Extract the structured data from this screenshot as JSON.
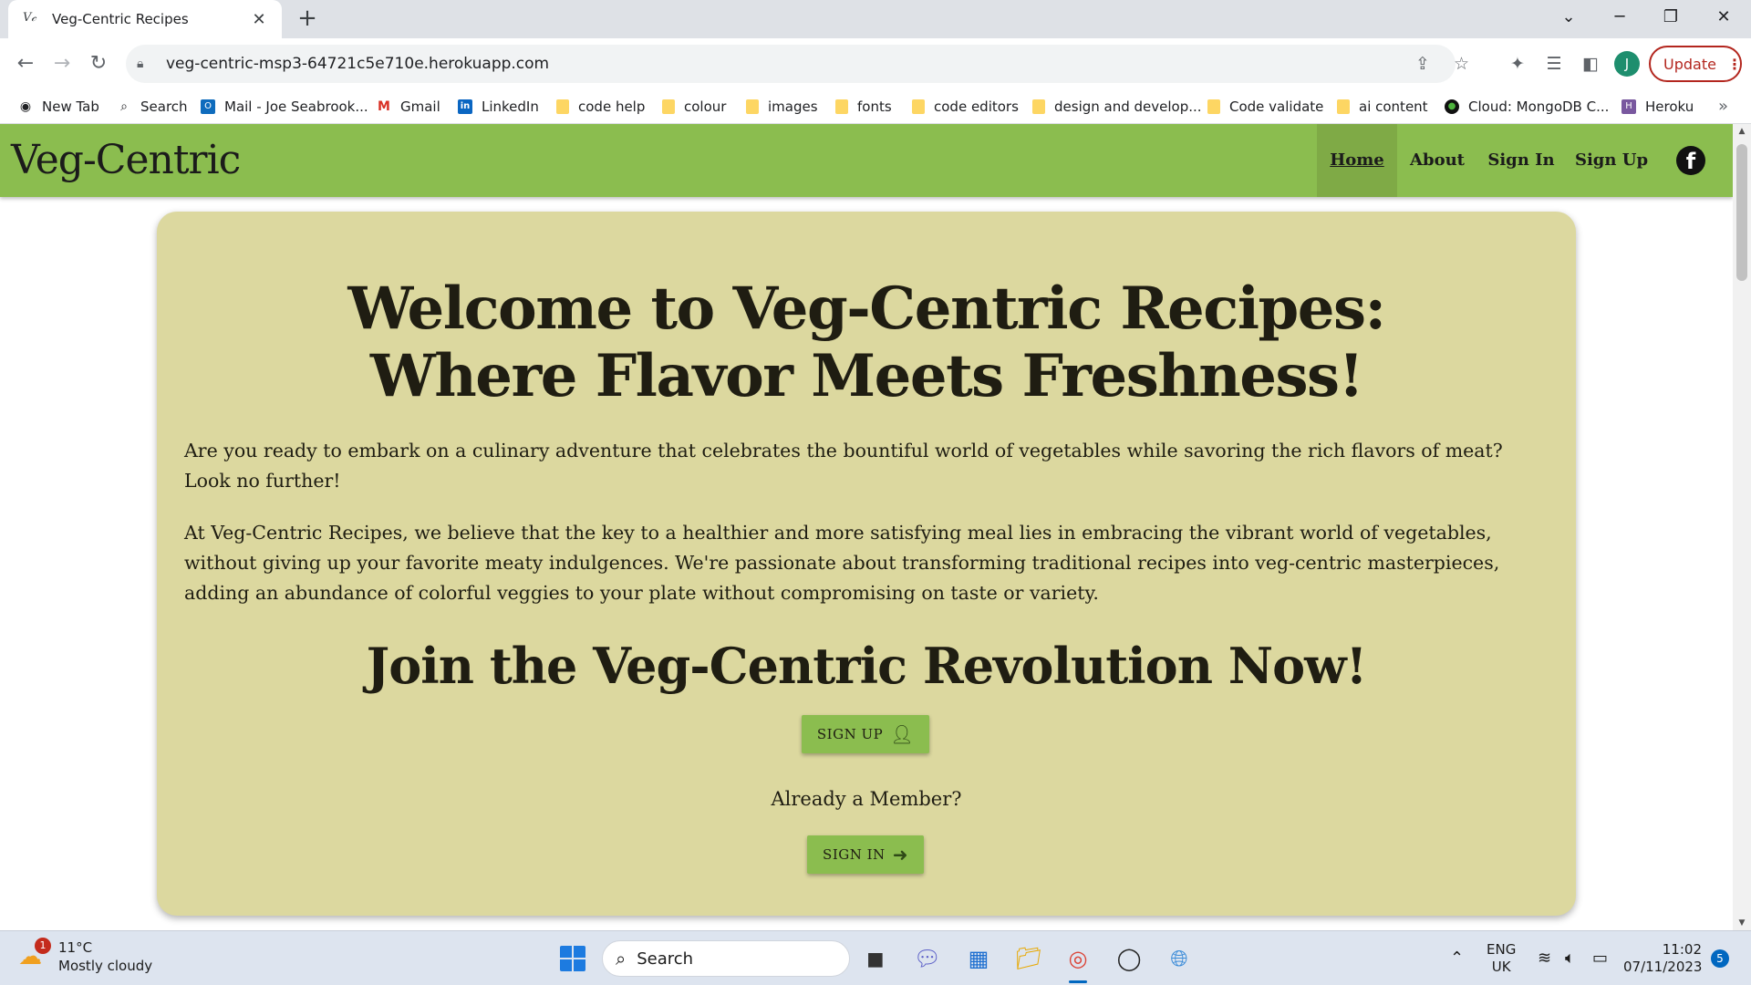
{
  "browser": {
    "tab_title": "Veg-Centric Recipes",
    "tab_favicon": "V𝒸",
    "url": "veg-centric-msp3-64721c5e710e.herokuapp.com",
    "update_label": "Update",
    "profile_initial": "J",
    "bookmarks": [
      {
        "label": "New Tab",
        "icon": "globe-icon"
      },
      {
        "label": "Search",
        "icon": "search-icon"
      },
      {
        "label": "Mail - Joe Seabrook...",
        "icon": "outlook-icon"
      },
      {
        "label": "Gmail",
        "icon": "gmail-icon"
      },
      {
        "label": "LinkedIn",
        "icon": "linkedin-icon"
      },
      {
        "label": "code help",
        "icon": "folder-icon"
      },
      {
        "label": "colour",
        "icon": "folder-icon"
      },
      {
        "label": "images",
        "icon": "folder-icon"
      },
      {
        "label": "fonts",
        "icon": "folder-icon"
      },
      {
        "label": "code editors",
        "icon": "folder-icon"
      },
      {
        "label": "design and develop...",
        "icon": "folder-icon"
      },
      {
        "label": "Code validate",
        "icon": "folder-icon"
      },
      {
        "label": "ai content",
        "icon": "folder-icon"
      },
      {
        "label": "Cloud: MongoDB C...",
        "icon": "mongodb-icon"
      },
      {
        "label": "Heroku",
        "icon": "heroku-icon"
      }
    ]
  },
  "site": {
    "brand": "Veg-Centric",
    "nav": [
      "Home",
      "About",
      "Sign In",
      "Sign Up"
    ],
    "facebook_glyph": "f",
    "heading_line1": "Welcome to Veg-Centric Recipes:",
    "heading_line2": "Where Flavor Meets Freshness!",
    "paragraph1": "Are you ready to embark on a culinary adventure that celebrates the bountiful world of vegetables while savoring the rich flavors of meat? Look no further!",
    "paragraph2": "At Veg-Centric Recipes, we believe that the key to a healthier and more satisfying meal lies in embracing the vibrant world of vegetables, without giving up your favorite meaty indulgences. We're passionate about transforming traditional recipes into veg-centric masterpieces, adding an abundance of colorful veggies to your plate without compromising on taste or variety.",
    "join_heading": "Join the Veg-Centric Revolution Now!",
    "signup_button": "SIGN UP",
    "member_text": "Already a Member?",
    "signin_button": "SIGN IN",
    "colors": {
      "nav_green": "#8bbd4f",
      "card_bg": "#dcd89f",
      "button_green": "#8bbd4f"
    }
  },
  "taskbar": {
    "weather_temp": "11°C",
    "weather_desc": "Mostly cloudy",
    "weather_badge": "1",
    "search_placeholder": "Search",
    "lang_line1": "ENG",
    "lang_line2": "UK",
    "time": "11:02",
    "date": "07/11/2023",
    "notification_count": "5"
  }
}
